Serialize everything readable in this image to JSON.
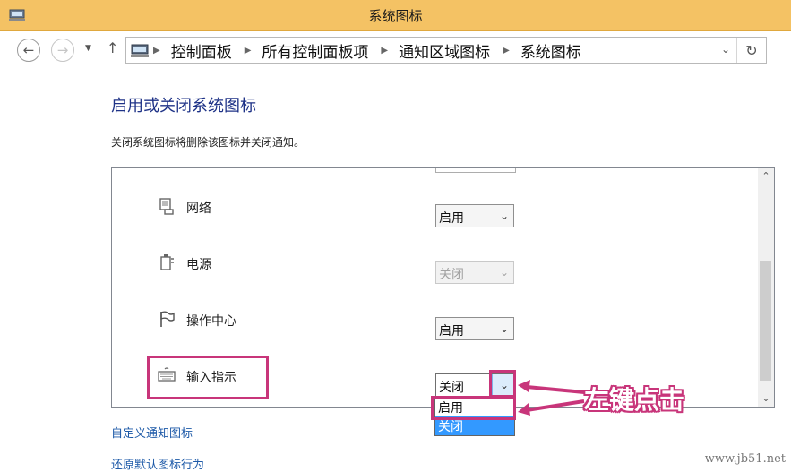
{
  "window": {
    "title": "系统图标"
  },
  "navigation": {
    "back_icon": "back-arrow-icon",
    "forward_icon": "forward-arrow-icon",
    "recent_icon": "chevron-down-icon",
    "up_icon": "up-arrow-icon",
    "breadcrumbs": [
      "控制面板",
      "所有控制面板项",
      "通知区域图标",
      "系统图标"
    ],
    "refresh_icon": "refresh-icon"
  },
  "page": {
    "title": "启用或关闭系统图标",
    "description": "关闭系统图标将删除该图标并关闭通知。"
  },
  "icon_rows": [
    {
      "name": "网络",
      "icon": "network-icon",
      "state": "启用",
      "enabled": true
    },
    {
      "name": "电源",
      "icon": "power-icon",
      "state": "关闭",
      "enabled": false
    },
    {
      "name": "操作中心",
      "icon": "flag-icon",
      "state": "启用",
      "enabled": true
    },
    {
      "name": "输入指示",
      "icon": "keyboard-icon",
      "state": "关闭",
      "enabled": true,
      "open": true
    }
  ],
  "dropdown_options": [
    "启用",
    "关闭"
  ],
  "dropdown_highlighted": "关闭",
  "links": {
    "customize": "自定义通知图标",
    "restore": "还原默认图标行为"
  },
  "annotation": {
    "text": "左键点击",
    "color": "#c8357a"
  },
  "watermark": "www.jb51.net",
  "colors": {
    "titlebar": "#f4c264",
    "heading": "#1e3287",
    "link": "#1e5aa8",
    "selection": "#3399ff"
  }
}
